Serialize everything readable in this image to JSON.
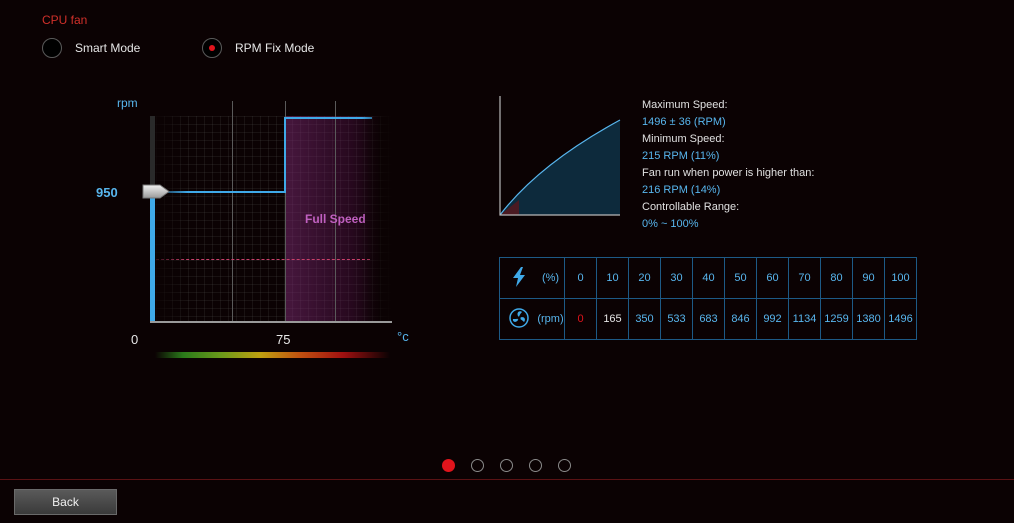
{
  "title": "CPU fan",
  "modes": [
    {
      "label": "Smart Mode",
      "selected": false
    },
    {
      "label": "RPM Fix Mode",
      "selected": true
    }
  ],
  "graph": {
    "y_unit": "rpm",
    "current_rpm": "950",
    "x_ticks": [
      "0",
      "75"
    ],
    "x_unit": "°c",
    "full_speed_label": "Full Speed"
  },
  "info": {
    "max_speed_label": "Maximum Speed:",
    "max_speed_value": "1496 ± 36 (RPM)",
    "min_speed_label": "Minimum Speed:",
    "min_speed_value": "215 RPM (11%)",
    "fan_run_label": "Fan run when power is higher than:",
    "fan_run_value": "216 RPM (14%)",
    "range_label": "Controllable Range:",
    "range_value": "0% ~ 100%"
  },
  "table": {
    "power_unit": "(%)",
    "rpm_unit": "(rpm)",
    "percent": [
      "0",
      "10",
      "20",
      "30",
      "40",
      "50",
      "60",
      "70",
      "80",
      "90",
      "100"
    ],
    "rpm": [
      "0",
      "165",
      "350",
      "533",
      "683",
      "846",
      "992",
      "1134",
      "1259",
      "1380",
      "1496"
    ]
  },
  "pagination": {
    "count": 5,
    "active": 0
  },
  "back_label": "Back",
  "colors": {
    "accent": "#e0141c",
    "blue": "#58b6ee",
    "border": "#1d5a86"
  }
}
